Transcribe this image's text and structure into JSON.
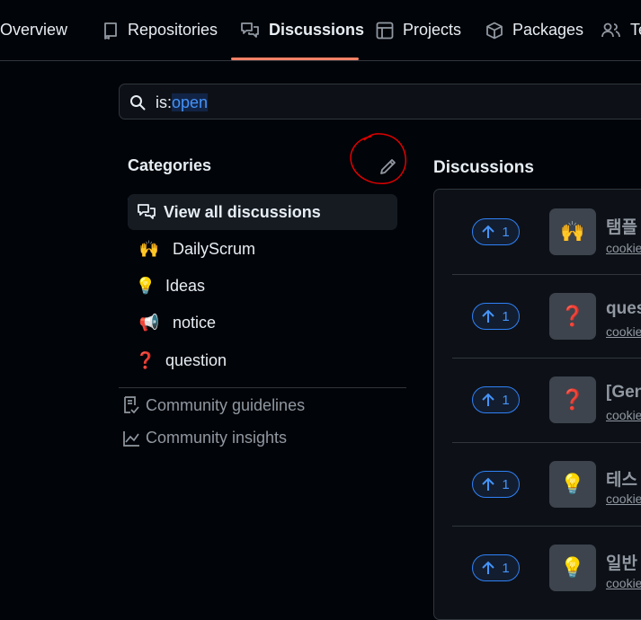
{
  "nav": {
    "tabs": [
      {
        "label": "Overview",
        "icon": "book-icon"
      },
      {
        "label": "Repositories",
        "icon": "repo-icon"
      },
      {
        "label": "Discussions",
        "icon": "discussions-icon",
        "selected": true
      },
      {
        "label": "Projects",
        "icon": "table-icon"
      },
      {
        "label": "Packages",
        "icon": "package-icon"
      },
      {
        "label": "Te",
        "icon": "people-icon"
      }
    ]
  },
  "search": {
    "prefix": "is:",
    "value": "open"
  },
  "categories": {
    "title": "Categories",
    "items": [
      {
        "label": "View all discussions",
        "icon": "discussions-icon",
        "active": true
      },
      {
        "label": "DailyScrum",
        "emoji": "🙌"
      },
      {
        "label": "Ideas",
        "emoji": "💡"
      },
      {
        "label": "notice",
        "emoji": "📢"
      },
      {
        "label": "question",
        "emoji": "❓"
      }
    ]
  },
  "links": {
    "guidelines": "Community guidelines",
    "insights": "Community insights"
  },
  "discussions": {
    "heading": "Discussions",
    "rows": [
      {
        "votes": "1",
        "emoji": "🙌",
        "title": "탬플",
        "meta": "cookie"
      },
      {
        "votes": "1",
        "emoji": "❓",
        "title": "ques",
        "meta": "cookie"
      },
      {
        "votes": "1",
        "emoji": "❓",
        "title": "[Gen",
        "meta": "cookie"
      },
      {
        "votes": "1",
        "emoji": "💡",
        "title": "테스",
        "meta": "cookie"
      },
      {
        "votes": "1",
        "emoji": "💡",
        "title": "일반",
        "meta": "cookie"
      }
    ]
  },
  "colors": {
    "accent": "#2f81f7",
    "selected_underline": "#f78166",
    "annotation": "#e00000"
  }
}
